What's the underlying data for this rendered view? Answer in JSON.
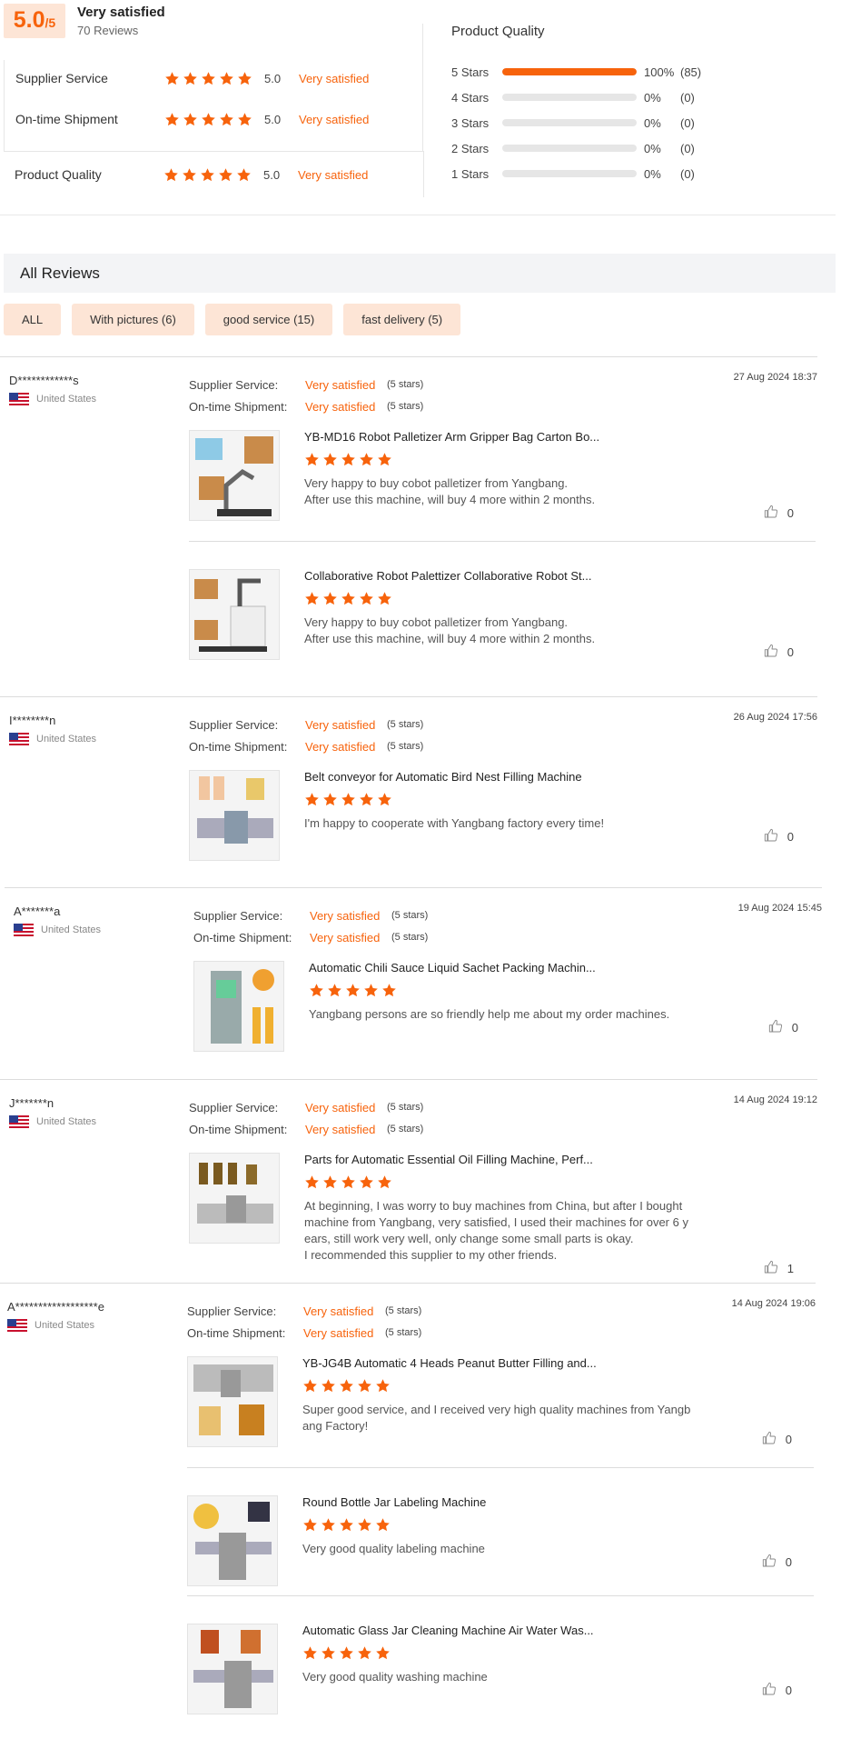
{
  "summary": {
    "score": "5.0",
    "score_unit": "/5",
    "title": "Very satisfied",
    "count": "70 Reviews",
    "metrics": [
      {
        "label": "Supplier Service",
        "score": "5.0",
        "desc": "Very satisfied",
        "stars": 5
      },
      {
        "label": "On-time Shipment",
        "score": "5.0",
        "desc": "Very satisfied",
        "stars": 5
      },
      {
        "label": "Product Quality",
        "score": "5.0",
        "desc": "Very satisfied",
        "stars": 5
      }
    ],
    "product_quality": {
      "title": "Product Quality",
      "rows": [
        {
          "label": "5 Stars",
          "fraction": 1.0,
          "percent": "100%",
          "count": "(85)"
        },
        {
          "label": "4 Stars",
          "fraction": 0,
          "percent": "0%",
          "count": "(0)"
        },
        {
          "label": "3 Stars",
          "fraction": 0,
          "percent": "0%",
          "count": "(0)"
        },
        {
          "label": "2 Stars",
          "fraction": 0,
          "percent": "0%",
          "count": "(0)"
        },
        {
          "label": "1 Stars",
          "fraction": 0,
          "percent": "0%",
          "count": "(0)"
        }
      ]
    }
  },
  "all_reviews": {
    "title": "All Reviews",
    "filters": [
      "ALL",
      "With pictures (6)",
      "good service (15)",
      "fast delivery (5)"
    ]
  },
  "labels": {
    "supplier_service": "Supplier Service:",
    "ontime_shipment": "On-time Shipment:",
    "stars_note": "(5 stars)"
  },
  "reviews": [
    {
      "name": "D************s",
      "country": "United States",
      "supplier_service": "Very satisfied",
      "ontime": "Very satisfied",
      "date": "27 Aug 2024 18:37",
      "products": [
        {
          "title": "YB-MD16 Robot Palletizer Arm Gripper Bag Carton Bo...",
          "lines": [
            "Very happy to buy cobot palletizer from Yangbang.",
            "After use this machine, will buy 4 more within 2 months."
          ],
          "likes": "0",
          "rating": 5
        },
        {
          "title": "Collaborative Robot Palettizer Collaborative Robot St...",
          "lines": [
            "Very happy to buy cobot palletizer from Yangbang.",
            "After use this machine, will buy 4 more within 2 months."
          ],
          "likes": "0",
          "rating": 5
        }
      ]
    },
    {
      "name": "I********n",
      "country": "United States",
      "supplier_service": "Very satisfied",
      "ontime": "Very satisfied",
      "date": "26 Aug 2024 17:56",
      "products": [
        {
          "title": "Belt conveyor for Automatic Bird Nest Filling Machine",
          "lines": [
            "I'm happy to cooperate with Yangbang factory every time!"
          ],
          "likes": "0",
          "rating": 5
        }
      ]
    },
    {
      "name": "A*******a",
      "country": "United States",
      "supplier_service": "Very satisfied",
      "ontime": "Very satisfied",
      "date": "19 Aug 2024 15:45",
      "products": [
        {
          "title": "Automatic Chili Sauce Liquid Sachet Packing Machin...",
          "lines": [
            "Yangbang persons are so friendly help me about my order machines."
          ],
          "likes": "0",
          "rating": 5
        }
      ]
    },
    {
      "name": "J*******n",
      "country": "United States",
      "supplier_service": "Very satisfied",
      "ontime": "Very satisfied",
      "date": "14 Aug 2024 19:12",
      "products": [
        {
          "title": "Parts for Automatic Essential Oil Filling Machine, Perf...",
          "lines": [
            "At beginning, I was worry to buy machines from China, but after I bought",
            "machine from Yangbang, very satisfied, I used their machines for over 6 y",
            "ears, still work very well, only change some small parts is okay.",
            "I recommended this supplier to my other friends."
          ],
          "likes": "1",
          "rating": 5
        }
      ]
    },
    {
      "name": "A******************e",
      "country": "United States",
      "supplier_service": "Very satisfied",
      "ontime": "Very satisfied",
      "date": "14 Aug 2024 19:06",
      "products": [
        {
          "title": "YB-JG4B Automatic 4 Heads Peanut Butter Filling and...",
          "lines": [
            "Super good service, and I received very high quality machines from Yangb",
            "ang Factory!"
          ],
          "likes": "0",
          "rating": 5
        },
        {
          "title": "Round Bottle Jar Labeling Machine",
          "lines": [
            "Very good quality labeling machine"
          ],
          "likes": "0",
          "rating": 5
        },
        {
          "title": "Automatic Glass Jar Cleaning Machine Air Water Was...",
          "lines": [
            "Very good quality washing machine"
          ],
          "likes": "0",
          "rating": 5
        }
      ]
    }
  ],
  "colors": {
    "accent": "#f7630c",
    "chip_bg": "#fde5d6",
    "header_bg": "#f3f4f6"
  }
}
